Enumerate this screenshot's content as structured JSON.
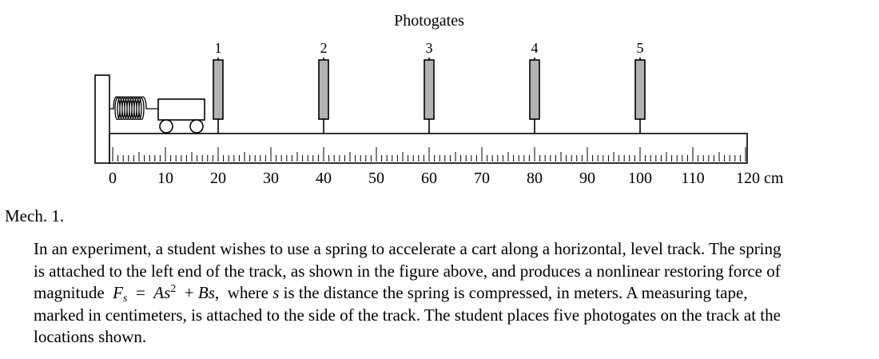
{
  "figure": {
    "title": "Photogates",
    "scale_labels": [
      "0",
      "10",
      "20",
      "30",
      "40",
      "50",
      "60",
      "70",
      "80",
      "90",
      "100",
      "110"
    ],
    "scale_end_label": "120 cm",
    "scale_range_cm": [
      0,
      120
    ],
    "photogates": [
      {
        "label": "1",
        "position_cm": 20
      },
      {
        "label": "2",
        "position_cm": 40
      },
      {
        "label": "3",
        "position_cm": 60
      },
      {
        "label": "4",
        "position_cm": 80
      },
      {
        "label": "5",
        "position_cm": 100
      }
    ],
    "colors": {
      "photogate_fill": "#b3b3b3",
      "line": "#000000"
    }
  },
  "problem": {
    "label": "Mech. 1.",
    "lines": [
      "In an experiment, a student wishes to use a spring to accelerate a cart along a horizontal, level track. The spring",
      "is attached to the left end of the track, as shown in the figure above, and produces a nonlinear restoring force of"
    ],
    "eq": {
      "lead": "magnitude",
      "F": "F",
      "F_sub": "s",
      "equals": "=",
      "A": "A",
      "s": "s",
      "exp": "2",
      "plus": "+",
      "B": "B",
      "s2": "s",
      "comma": ",",
      "where": "where",
      "s_var": "s",
      "rest": "is the distance the spring is compressed, in meters. A measuring tape,"
    },
    "lines_after": [
      "marked in centimeters, is attached to the side of the track. The student places five photogates on the track at the",
      "locations shown."
    ]
  }
}
